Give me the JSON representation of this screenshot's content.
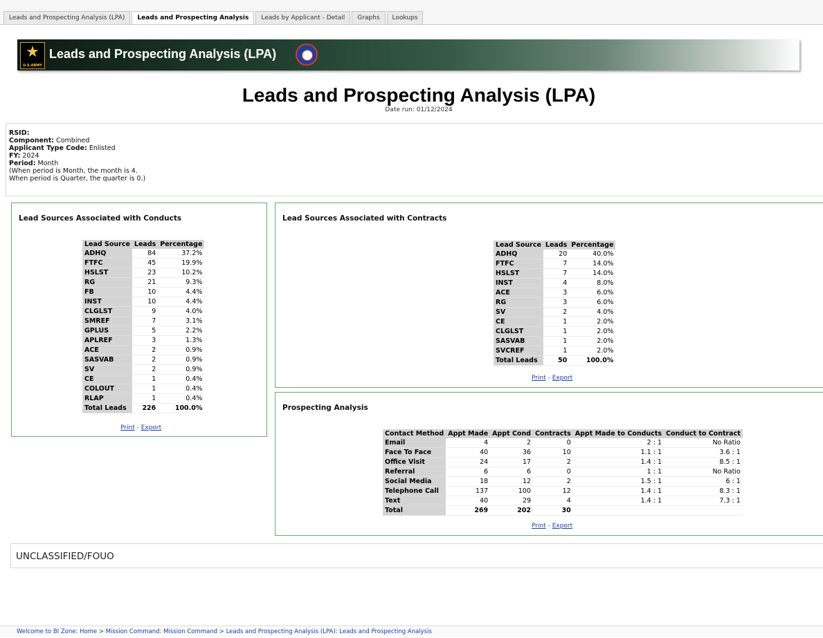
{
  "tabs": [
    {
      "label": "Leads and Prospecting Analysis (LPA)"
    },
    {
      "label": "Leads and Prospecting Analysis"
    },
    {
      "label": "Leads by Applicant - Detail"
    },
    {
      "label": "Graphs"
    },
    {
      "label": "Lookups"
    }
  ],
  "banner": {
    "title": "Leads and Prospecting Analysis (LPA)",
    "logo_text": "U.S.ARMY",
    "logo_icon": "star-icon",
    "seal_icon": "recruiting-seal-icon"
  },
  "report": {
    "title": "Leads and Prospecting Analysis (LPA)",
    "date_run": "Date run: 01/12/2024"
  },
  "params": {
    "rsid_label": "RSID",
    "rsid_value": "",
    "component_label": "Component",
    "component_value": "Combined",
    "applicant_type_label": "Applicant Type Code",
    "applicant_type_value": "Enlisted",
    "fy_label": "FY",
    "fy_value": "2024",
    "period_label": "Period",
    "period_value": "Month",
    "note1": "(When period is Month, the month is 4.",
    "note2": "When period is Quarter, the quarter is 0.)"
  },
  "conducts": {
    "title": "Lead Sources Associated with Conducts",
    "headers": [
      "Lead Source",
      "Leads",
      "Percentage"
    ],
    "rows": [
      [
        "ADHQ",
        "84",
        "37.2%"
      ],
      [
        "FTFC",
        "45",
        "19.9%"
      ],
      [
        "HSLST",
        "23",
        "10.2%"
      ],
      [
        "RG",
        "21",
        "9.3%"
      ],
      [
        "FB",
        "10",
        "4.4%"
      ],
      [
        "INST",
        "10",
        "4.4%"
      ],
      [
        "CLGLST",
        "9",
        "4.0%"
      ],
      [
        "SMREF",
        "7",
        "3.1%"
      ],
      [
        "GPLUS",
        "5",
        "2.2%"
      ],
      [
        "APLREF",
        "3",
        "1.3%"
      ],
      [
        "ACE",
        "2",
        "0.9%"
      ],
      [
        "SASVAB",
        "2",
        "0.9%"
      ],
      [
        "SV",
        "2",
        "0.9%"
      ],
      [
        "CE",
        "1",
        "0.4%"
      ],
      [
        "COLOUT",
        "1",
        "0.4%"
      ],
      [
        "RLAP",
        "1",
        "0.4%"
      ]
    ],
    "total": [
      "Total Leads",
      "226",
      "100.0%"
    ],
    "print": "Print",
    "export": "Export"
  },
  "contracts": {
    "title": "Lead Sources Associated with Contracts",
    "headers": [
      "Lead Source",
      "Leads",
      "Percentage"
    ],
    "rows": [
      [
        "ADHQ",
        "20",
        "40.0%"
      ],
      [
        "FTFC",
        "7",
        "14.0%"
      ],
      [
        "HSLST",
        "7",
        "14.0%"
      ],
      [
        "INST",
        "4",
        "8.0%"
      ],
      [
        "ACE",
        "3",
        "6.0%"
      ],
      [
        "RG",
        "3",
        "6.0%"
      ],
      [
        "SV",
        "2",
        "4.0%"
      ],
      [
        "CE",
        "1",
        "2.0%"
      ],
      [
        "CLGLST",
        "1",
        "2.0%"
      ],
      [
        "SASVAB",
        "1",
        "2.0%"
      ],
      [
        "SVCREF",
        "1",
        "2.0%"
      ]
    ],
    "total": [
      "Total Leads",
      "50",
      "100.0%"
    ],
    "print": "Print",
    "export": "Export"
  },
  "prospecting": {
    "title": "Prospecting Analysis",
    "headers": [
      "Contact Method",
      "Appt Made",
      "Appt Cond",
      "Contracts",
      "Appt Made to Conducts",
      "Conduct to Contract"
    ],
    "rows": [
      [
        "Email",
        "4",
        "2",
        "0",
        "2 : 1",
        "No Ratio"
      ],
      [
        "Face To Face",
        "40",
        "36",
        "10",
        "1.1 : 1",
        "3.6 : 1"
      ],
      [
        "Office Visit",
        "24",
        "17",
        "2",
        "1.4 : 1",
        "8.5 : 1"
      ],
      [
        "Referral",
        "6",
        "6",
        "0",
        "1 : 1",
        "No Ratio"
      ],
      [
        "Social Media",
        "18",
        "12",
        "2",
        "1.5 : 1",
        "6 : 1"
      ],
      [
        "Telephone Call",
        "137",
        "100",
        "12",
        "1.4 : 1",
        "8.3 : 1"
      ],
      [
        "Text",
        "40",
        "29",
        "4",
        "1.4 : 1",
        "7.3 : 1"
      ]
    ],
    "total": [
      "Total",
      "269",
      "202",
      "30",
      "",
      ""
    ],
    "print": "Print",
    "export": "Export"
  },
  "classification": "UNCLASSIFIED/FOUO",
  "footer": "Welcome to BI Zone: Home  >  Mission Command: Mission Command  >  Leads and Prospecting Analysis (LPA): Leads and Prospecting Analysis"
}
